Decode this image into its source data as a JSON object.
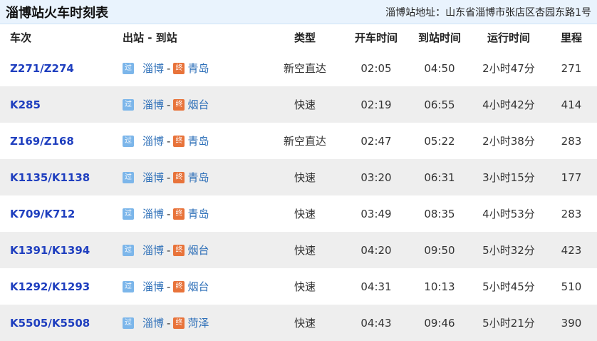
{
  "header": {
    "title": "淄博站火车时刻表",
    "address": "淄博站地址：山东省淄博市张店区杏园东路1号"
  },
  "columns": [
    "车次",
    "出站 - 到站",
    "类型",
    "开车时间",
    "到站时间",
    "运行时间",
    "里程"
  ],
  "badges": {
    "pass": "过",
    "end": "终"
  },
  "dash": "-",
  "rows": [
    {
      "train": "Z271/Z274",
      "from": "淄博",
      "to": "青岛",
      "type": "新空直达",
      "depart": "02:05",
      "arrive": "04:50",
      "duration": "2小时47分",
      "distance": "271"
    },
    {
      "train": "K285",
      "from": "淄博",
      "to": "烟台",
      "type": "快速",
      "depart": "02:19",
      "arrive": "06:55",
      "duration": "4小时42分",
      "distance": "414"
    },
    {
      "train": "Z169/Z168",
      "from": "淄博",
      "to": "青岛",
      "type": "新空直达",
      "depart": "02:47",
      "arrive": "05:22",
      "duration": "2小时38分",
      "distance": "283"
    },
    {
      "train": "K1135/K1138",
      "from": "淄博",
      "to": "青岛",
      "type": "快速",
      "depart": "03:20",
      "arrive": "06:31",
      "duration": "3小时15分",
      "distance": "177"
    },
    {
      "train": "K709/K712",
      "from": "淄博",
      "to": "青岛",
      "type": "快速",
      "depart": "03:49",
      "arrive": "08:35",
      "duration": "4小时53分",
      "distance": "283"
    },
    {
      "train": "K1391/K1394",
      "from": "淄博",
      "to": "烟台",
      "type": "快速",
      "depart": "04:20",
      "arrive": "09:50",
      "duration": "5小时32分",
      "distance": "423"
    },
    {
      "train": "K1292/K1293",
      "from": "淄博",
      "to": "烟台",
      "type": "快速",
      "depart": "04:31",
      "arrive": "10:13",
      "duration": "5小时45分",
      "distance": "510"
    },
    {
      "train": "K5505/K5508",
      "from": "淄博",
      "to": "菏泽",
      "type": "快速",
      "depart": "04:43",
      "arrive": "09:46",
      "duration": "5小时21分",
      "distance": "390"
    }
  ]
}
